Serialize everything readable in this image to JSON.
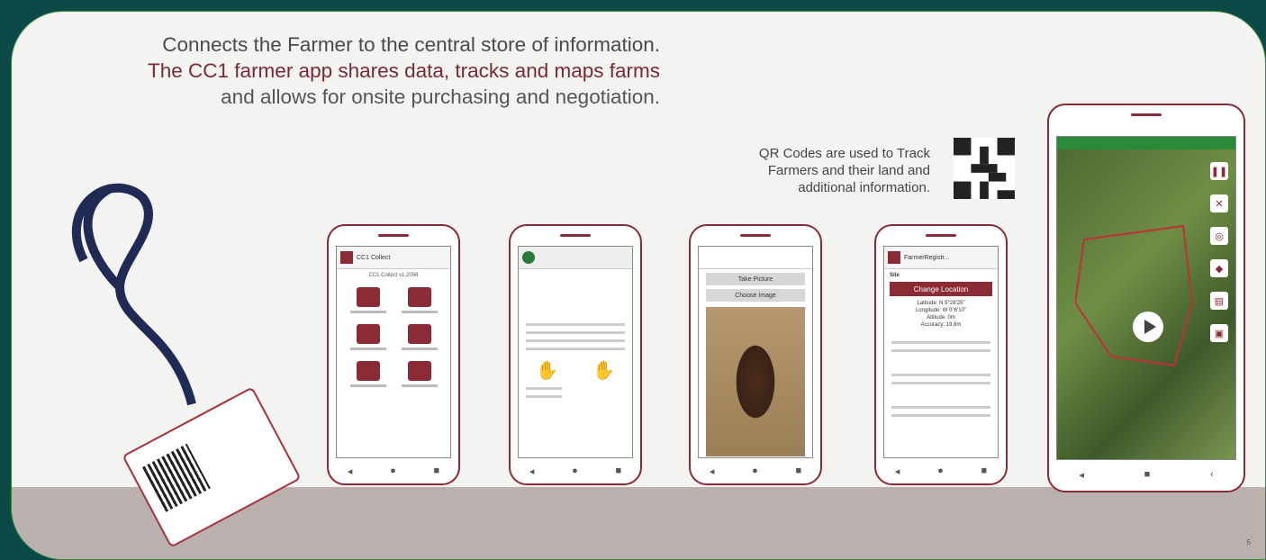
{
  "headline": {
    "line1": "Connects the Farmer to the central store of information.",
    "line2": "The CC1 farmer app shares data, tracks and maps farms",
    "line3": "and allows for onsite purchasing and negotiation."
  },
  "qr_caption": {
    "line1": "QR Codes are used to Track",
    "line2": "Farmers and their land and",
    "line3": "additional information."
  },
  "phone1": {
    "title": "CC1 Collect",
    "subtitle": "CC1 Collect v1.2056"
  },
  "phone3": {
    "take_picture": "Take Picture",
    "choose_image": "Choose Image"
  },
  "phone4": {
    "title": "FarmerRegistr...",
    "change_location": "Change Location",
    "site": "Site",
    "latitude": "Latitude: N 5°28'25\"",
    "longitude": "Longitude: W 0°6'10\"",
    "altitude": "Altitude: 0m",
    "accuracy": "Accuracy: 19.8m"
  },
  "icons": {
    "nav_back": "triangle-back",
    "nav_home": "circle-home",
    "nav_recent": "square-recent"
  },
  "page_number": "5",
  "colors": {
    "accent": "#8a2b35",
    "frame": "#0c4a47"
  }
}
